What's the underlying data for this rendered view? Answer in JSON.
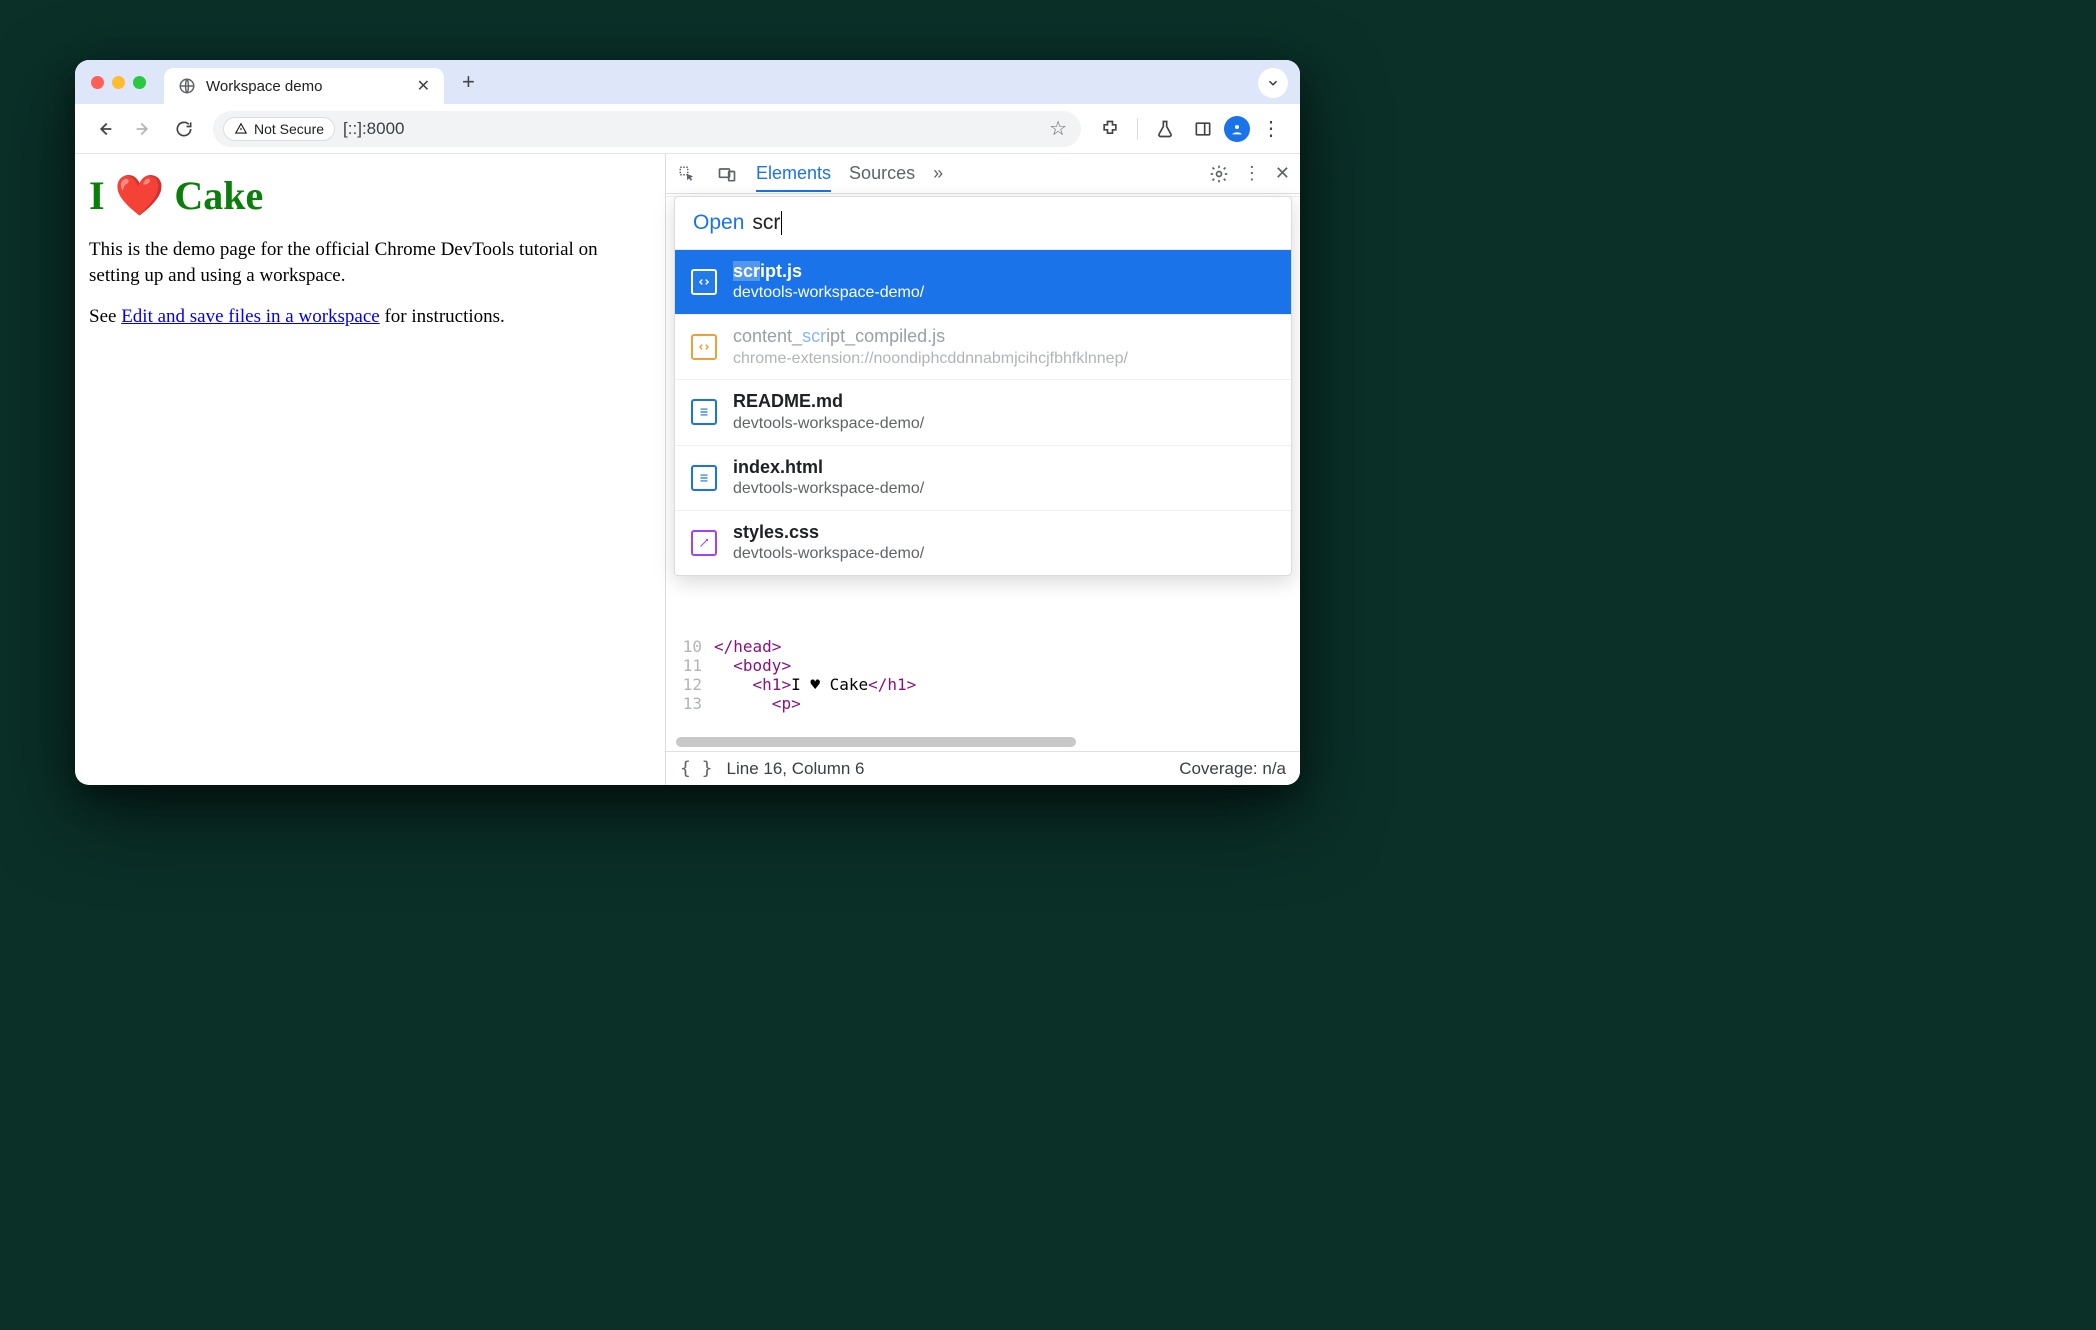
{
  "browser": {
    "tab_title": "Workspace demo",
    "security_label": "Not Secure",
    "url": "[::]:8000"
  },
  "page": {
    "heading": "I ❤️ Cake",
    "paragraph": "This is the demo page for the official Chrome DevTools tutorial on setting up and using a workspace.",
    "see_prefix": "See ",
    "link_text": "Edit and save files in a workspace",
    "see_suffix": " for instructions."
  },
  "devtools": {
    "tabs": {
      "elements": "Elements",
      "sources": "Sources",
      "more": "»"
    },
    "open": {
      "label": "Open",
      "query": "scr",
      "items": [
        {
          "file": "script.js",
          "path": "devtools-workspace-demo/",
          "icon": "js",
          "selected": true,
          "dim": false
        },
        {
          "file": "content_script_compiled.js",
          "path": "chrome-extension://noondiphcddnnabmjcihcjfbhfklnnep/",
          "icon": "js",
          "selected": false,
          "dim": true
        },
        {
          "file": "README.md",
          "path": "devtools-workspace-demo/",
          "icon": "doc",
          "selected": false,
          "dim": false
        },
        {
          "file": "index.html",
          "path": "devtools-workspace-demo/",
          "icon": "doc",
          "selected": false,
          "dim": false
        },
        {
          "file": "styles.css",
          "path": "devtools-workspace-demo/",
          "icon": "css",
          "selected": false,
          "dim": false
        }
      ]
    },
    "code": {
      "line10": {
        "num": "10",
        "text_a": "</",
        "text_b": "head",
        "text_c": ">"
      },
      "line11": {
        "num": "11",
        "text_a": "<",
        "text_b": "body",
        "text_c": ">"
      },
      "line12": {
        "num": "12",
        "text_a": "<",
        "text_b": "h1",
        "text_c": ">",
        "content": "I ♥ Cake",
        "close_a": "</",
        "close_b": "h1",
        "close_c": ">"
      },
      "line13": {
        "num": "13",
        "text_a": "<",
        "text_b": "p",
        "text_c": ">"
      }
    },
    "status": {
      "position": "Line 16, Column 6",
      "coverage": "Coverage: n/a"
    }
  }
}
